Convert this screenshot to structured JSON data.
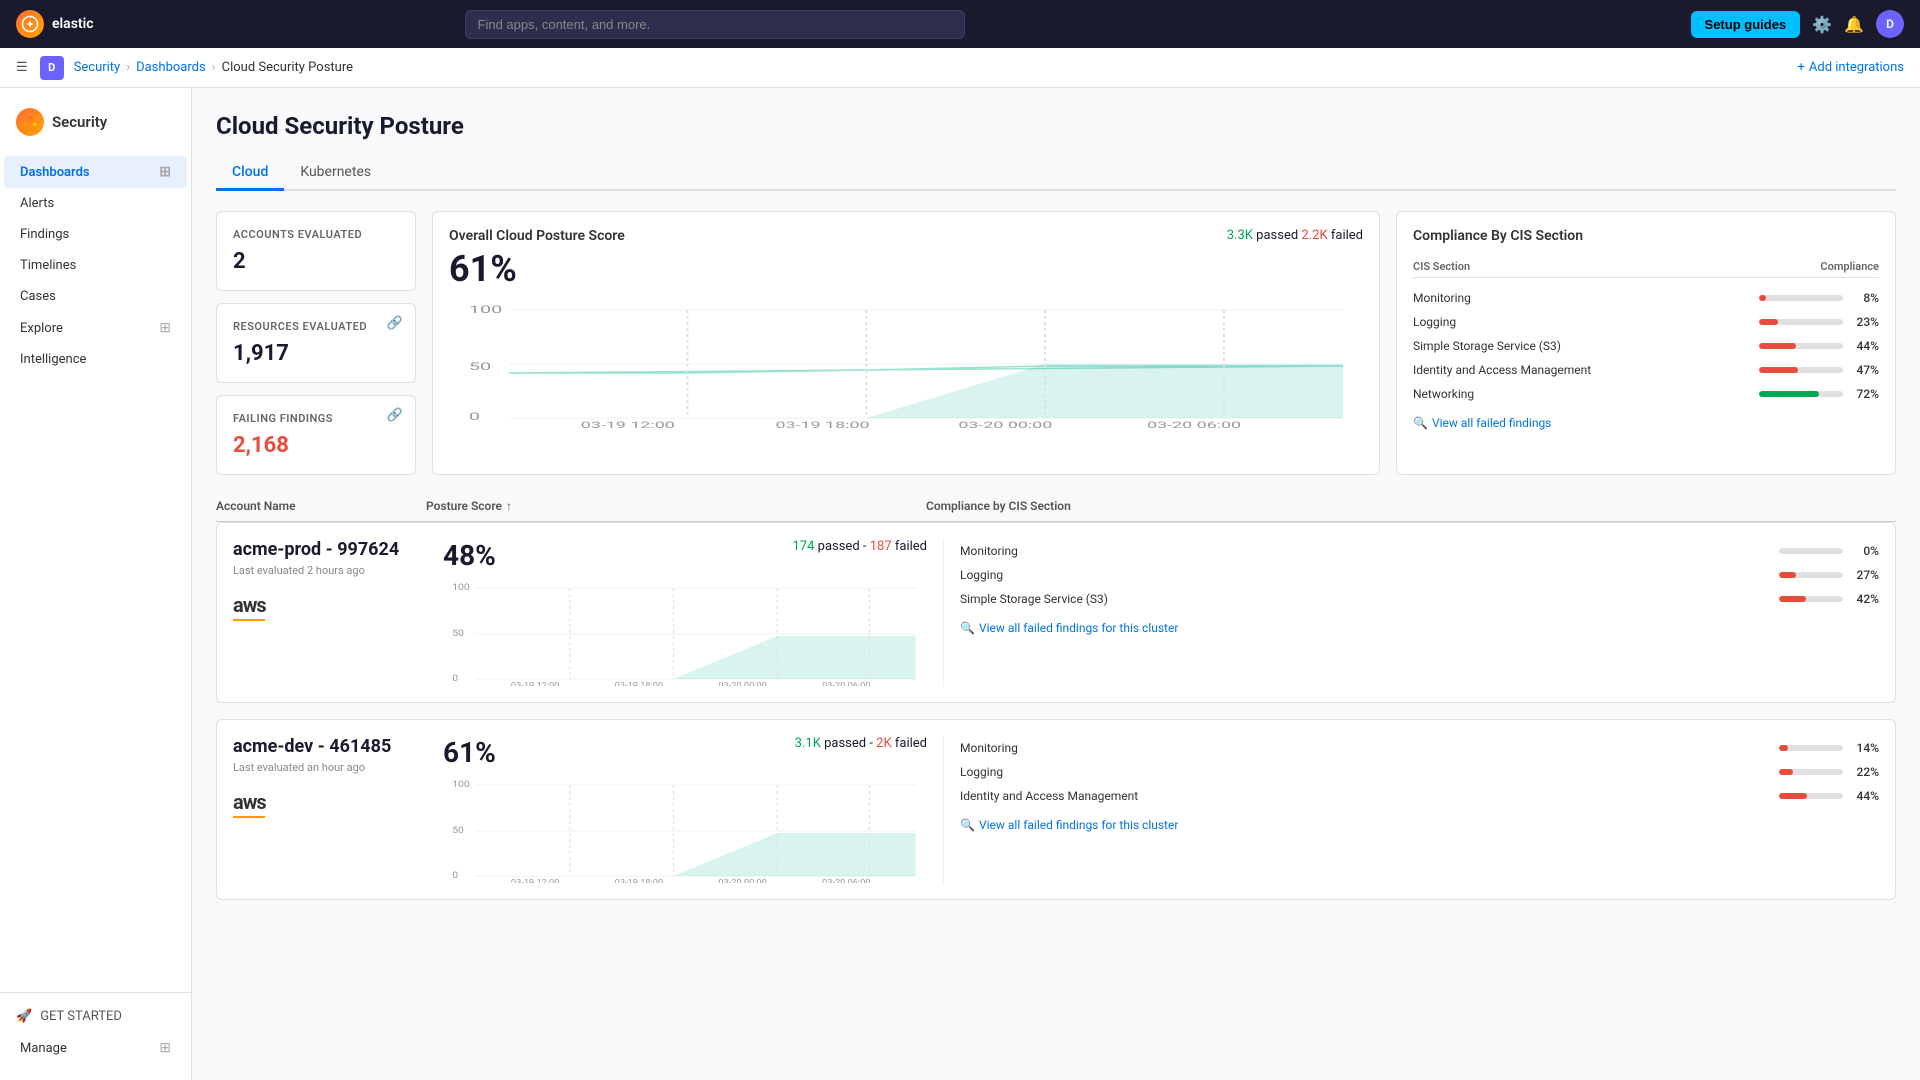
{
  "app": {
    "name": "elastic",
    "logo_text": "e"
  },
  "topnav": {
    "search_placeholder": "Find apps, content, and more.",
    "search_shortcut": "⌘/",
    "setup_guides_label": "Setup guides",
    "avatar_label": "D"
  },
  "breadcrumb": {
    "app_badge": "D",
    "items": [
      "Security",
      "Dashboards",
      "Cloud Security Posture"
    ],
    "add_integrations": "Add integrations"
  },
  "sidebar": {
    "logo_title": "Security",
    "items": [
      {
        "label": "Dashboards",
        "active": true,
        "has_icon": true
      },
      {
        "label": "Alerts",
        "active": false,
        "has_icon": false
      },
      {
        "label": "Findings",
        "active": false,
        "has_icon": false
      },
      {
        "label": "Timelines",
        "active": false,
        "has_icon": false
      },
      {
        "label": "Cases",
        "active": false,
        "has_icon": false
      },
      {
        "label": "Explore",
        "active": false,
        "has_icon": true
      },
      {
        "label": "Intelligence",
        "active": false,
        "has_icon": false
      }
    ],
    "get_started": "GET STARTED",
    "manage": "Manage"
  },
  "page": {
    "title": "Cloud Security Posture",
    "tabs": [
      "Cloud",
      "Kubernetes"
    ],
    "active_tab": 0
  },
  "stats": {
    "accounts_evaluated_label": "ACCOUNTS EVALUATED",
    "accounts_evaluated_value": "2",
    "resources_evaluated_label": "RESOURCES EVALUATED",
    "resources_evaluated_value": "1,917",
    "failing_findings_label": "FAILING FINDINGS",
    "failing_findings_value": "2,168"
  },
  "overall_score": {
    "title": "Overall Cloud Posture Score",
    "score": "61%",
    "passed_count": "3.3K",
    "passed_label": "passed",
    "failed_count": "2.2K",
    "failed_label": "failed",
    "chart_x_labels": [
      "03-19 12:00",
      "03-19 18:00",
      "03-20 00:00",
      "03-20 06:00"
    ],
    "chart_y_max": 100,
    "chart_y_mid": 50,
    "chart_y_min": 0
  },
  "cis_compliance": {
    "title": "Compliance By CIS Section",
    "col_section": "CIS Section",
    "col_compliance": "Compliance",
    "rows": [
      {
        "name": "Monitoring",
        "pct": 8,
        "green": false
      },
      {
        "name": "Logging",
        "pct": 23,
        "green": false
      },
      {
        "name": "Simple Storage Service (S3)",
        "pct": 44,
        "green": false
      },
      {
        "name": "Identity and Access Management",
        "pct": 47,
        "green": false
      },
      {
        "name": "Networking",
        "pct": 72,
        "green": true
      }
    ],
    "view_all_link": "View all failed findings"
  },
  "table_headers": {
    "account_name": "Account Name",
    "posture_score": "Posture Score",
    "cis_section": "Compliance by CIS Section"
  },
  "accounts": [
    {
      "name": "acme-prod - 997624",
      "subtitle": "Last evaluated 2 hours ago",
      "score": "48%",
      "passed_count": "174",
      "failed_count": "187",
      "cis_rows": [
        {
          "name": "Monitoring",
          "pct": 0,
          "green": false
        },
        {
          "name": "Logging",
          "pct": 27,
          "green": false
        },
        {
          "name": "Simple Storage Service (S3)",
          "pct": 42,
          "green": false
        }
      ],
      "view_all_link": "View all failed findings for this cluster"
    },
    {
      "name": "acme-dev - 461485",
      "subtitle": "Last evaluated an hour ago",
      "score": "61%",
      "passed_count": "3.1K",
      "failed_count": "2K",
      "cis_rows": [
        {
          "name": "Monitoring",
          "pct": 14,
          "green": false
        },
        {
          "name": "Logging",
          "pct": 22,
          "green": false
        },
        {
          "name": "Identity and Access Management",
          "pct": 44,
          "green": false
        }
      ],
      "view_all_link": "View all failed findings for this cluster"
    }
  ],
  "icons": {
    "search": "🔍",
    "bell": "🔔",
    "settings": "⚙️",
    "link": "🔗",
    "menu": "☰",
    "grid": "⊞",
    "rocket": "🚀",
    "sort_asc": "↑",
    "eye": "👁",
    "add": "+"
  }
}
